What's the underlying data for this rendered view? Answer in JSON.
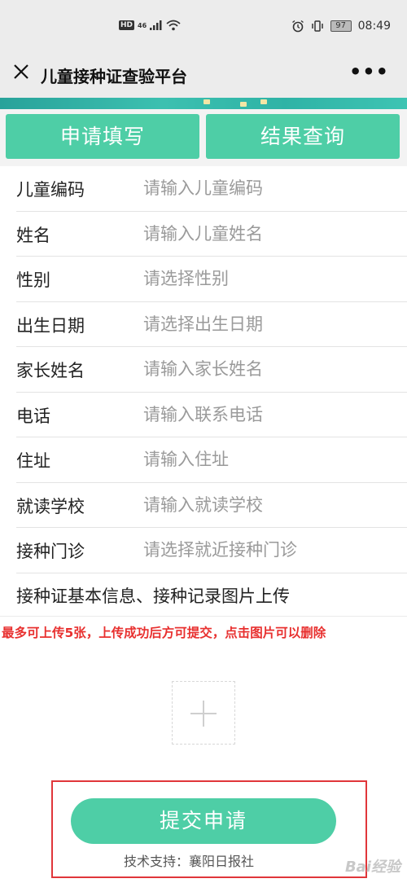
{
  "status": {
    "time": "08:49",
    "battery": "97",
    "hd": "HD",
    "signal": "46"
  },
  "nav": {
    "title": "儿童接种证查验平台",
    "more": "•••"
  },
  "tabs": [
    {
      "label": "申请填写"
    },
    {
      "label": "结果查询"
    }
  ],
  "form": {
    "rows": [
      {
        "label": "儿童编码",
        "placeholder": "请输入儿童编码"
      },
      {
        "label": "姓名",
        "placeholder": "请输入儿童姓名"
      },
      {
        "label": "性别",
        "placeholder": "请选择性别"
      },
      {
        "label": "出生日期",
        "placeholder": "请选择出生日期"
      },
      {
        "label": "家长姓名",
        "placeholder": "请输入家长姓名"
      },
      {
        "label": "电话",
        "placeholder": "请输入联系电话"
      },
      {
        "label": "住址",
        "placeholder": "请输入住址"
      },
      {
        "label": "就读学校",
        "placeholder": "请输入就读学校"
      },
      {
        "label": "接种门诊",
        "placeholder": "请选择就近接种门诊"
      }
    ]
  },
  "upload": {
    "title": "接种证基本信息、接种记录图片上传",
    "note": "最多可上传5张，上传成功后方可提交，点击图片可以删除"
  },
  "submit": {
    "label": "提交申请"
  },
  "support": "技术支持：襄阳日报社",
  "watermark": "Bai经验",
  "colors": {
    "accent": "#4ecea6",
    "warning": "#e8302f",
    "highlight": "#e0363a"
  }
}
